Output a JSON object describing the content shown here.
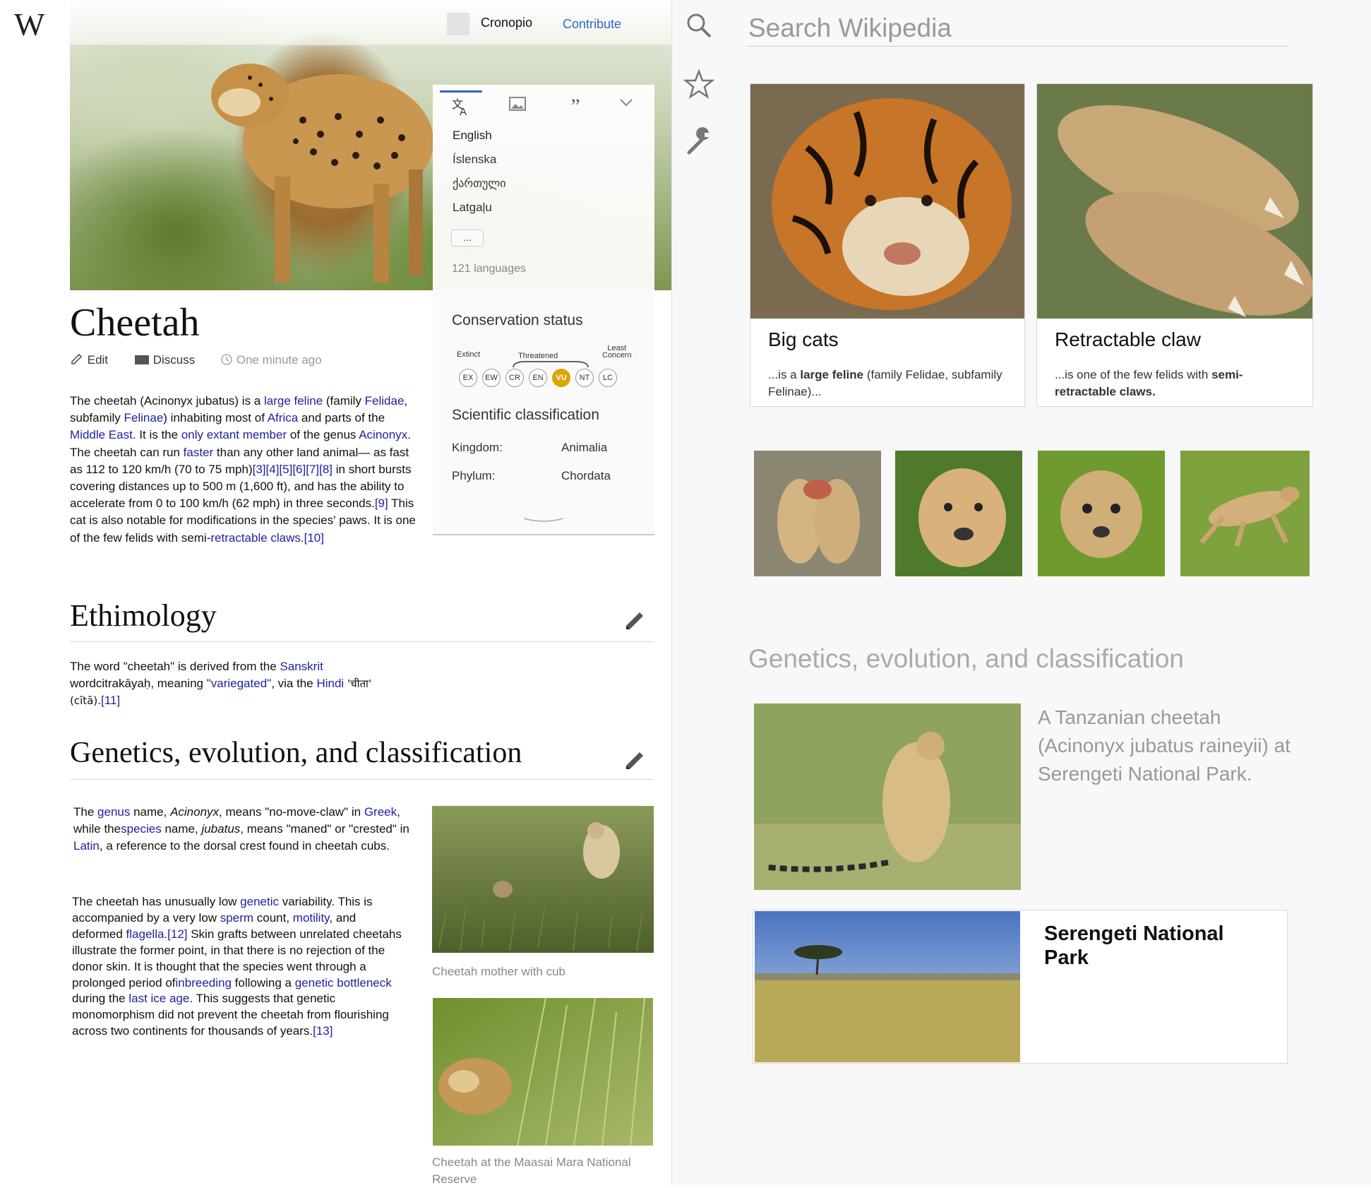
{
  "app": {
    "logo": "W"
  },
  "header": {
    "username": "Cronopio",
    "contribute": "Contribute"
  },
  "languages": {
    "items": [
      "English",
      "Íslenska",
      "ქართული",
      "Latgaļu"
    ],
    "more": "...",
    "count": "121 languages"
  },
  "infobox": {
    "conservation_title": "Conservation status",
    "labels": {
      "extinct": "Extinct",
      "threatened": "Threatened",
      "least_1": "Least",
      "least_2": "Concern"
    },
    "statuses": [
      "EX",
      "EW",
      "CR",
      "EN",
      "VU",
      "NT",
      "LC"
    ],
    "active_status": "VU",
    "active_color": "#d9a500",
    "classification_title": "Scientific classification",
    "rows": [
      {
        "key": "Kingdom:",
        "value": "Animalia"
      },
      {
        "key": "Phylum:",
        "value": "Chordata"
      }
    ]
  },
  "article": {
    "title": "Cheetah",
    "actions": {
      "edit": "Edit",
      "discuss": "Discuss",
      "last_edit": "One minute ago"
    },
    "intro": {
      "p1": "The cheetah (Acinonyx jubatus) is a ",
      "l1": "large feline",
      "p2": " (family ",
      "l2": "Felidae",
      "p3": ", subfamily ",
      "l3": "Felinae",
      "p4": ") inhabiting most of ",
      "l4": "Africa",
      "p5": " and parts of the ",
      "l5": "Middle East",
      "p6": ". It is the ",
      "l6": "only extant member",
      "p7": " of the genus ",
      "l7": "Acinonyx",
      "p8": ". The cheetah can run ",
      "l8": "faster",
      "p9": " than any other land animal— as fast as 112 to 120 km/h (70 to 75 mph)",
      "l9": "[3][4][5][6][7][8]",
      "p10": " in short bursts covering distances up to 500 m (1,600 ft), and has the ability to accelerate from 0 to 100 km/h (62 mph) in three seconds.",
      "l10": "[9]",
      "p11": " This cat is also notable for modifications in the species' paws. It is one of the few felids with semi-",
      "l11": "retractable claws.[10]"
    },
    "ethimology": {
      "heading": "Ethimology",
      "p1": "The word \"cheetah\" is derived from the ",
      "l1": "Sanskrit",
      "p2": " wordcitrakāyaḥ, meaning ",
      "l2": "\"variegated\"",
      "p3": ", via the ",
      "l3": "Hindi",
      "p4": " 'चीता' (cītā).",
      "l4": "[11]"
    },
    "genetics": {
      "heading": "Genetics, evolution, and classification",
      "a_p1": "The ",
      "a_l1": "genus",
      "a_p2": " name, ",
      "a_i1": "Acinonyx",
      "a_p3": ", means \"no-move-claw\" in ",
      "a_l2": "Greek",
      "a_p4": ", while the",
      "a_l3": "species",
      "a_p5": " name, ",
      "a_i2": "jubatus",
      "a_p6": ", means \"maned\" or \"crested\" in ",
      "a_l4": "Latin",
      "a_p7": ", a reference to the dorsal crest found in cheetah cubs.",
      "b_p1": "The cheetah has unusually low ",
      "b_l1": "genetic",
      "b_p2": " variability. This is accompanied by a very low ",
      "b_l2": "sperm",
      "b_p3": " count, ",
      "b_l3": "motility",
      "b_p4": ", and deformed ",
      "b_l4": "flagella.[12]",
      "b_p5": " Skin grafts between unrelated cheetahs illustrate the former point, in that there is no rejection of the donor skin. It is thought that the species went through a prolonged period of",
      "b_l5": "inbreeding",
      "b_p6": " following a ",
      "b_l6": "genetic bottleneck",
      "b_p7": " during the ",
      "b_l7": "last ice age",
      "b_p8": ". This suggests that genetic monomorphism did not prevent the cheetah from flourishing across two continents for thousands of years.",
      "b_l8": "[13]",
      "caption1": "Cheetah mother with cub",
      "caption2": "Cheetah at the Maasai Mara National Reserve"
    }
  },
  "sidebar": {
    "search_placeholder": "Search Wikipedia",
    "cards": [
      {
        "title": "Big cats",
        "desc_pre": "...is a ",
        "desc_bold": "large feline",
        "desc_post": " (family Felidae, subfamily Felinae)..."
      },
      {
        "title": "Retractable claw",
        "desc_pre": "...is one of the few felids with ",
        "desc_bold": "semi-retractable claws.",
        "desc_post": ""
      }
    ],
    "section_heading": "Genetics, evolution, and classification",
    "feature_caption": "A Tanzanian cheetah (Acinonyx jubatus raineyii) at Serengeti National Park.",
    "related_title": "Serengeti National Park"
  },
  "colors": {
    "link": "#1f1fa0",
    "accent": "#3366cc"
  }
}
